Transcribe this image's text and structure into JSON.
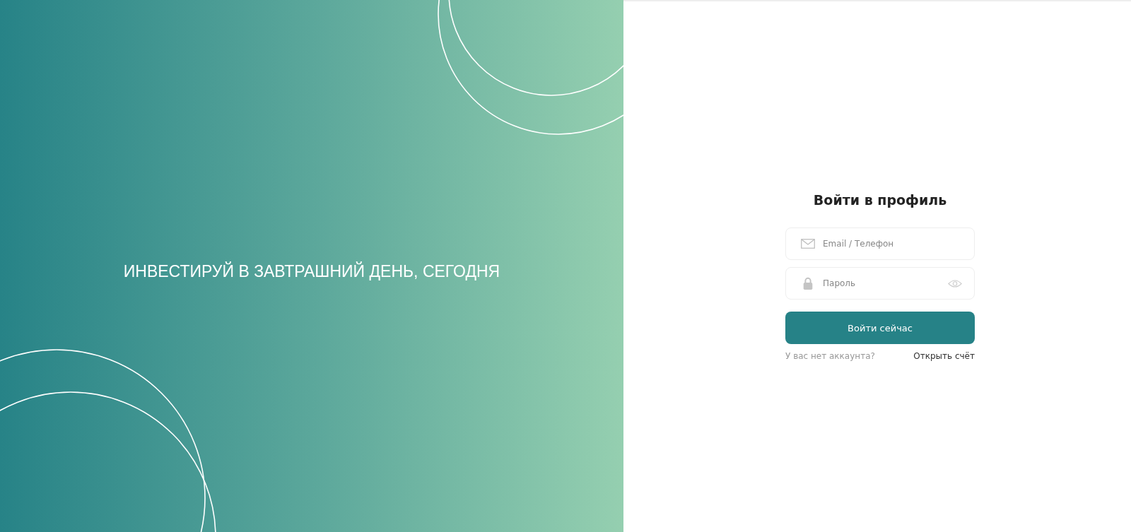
{
  "hero": {
    "slogan": "ИНВЕСТИРУЙ В ЗАВТРАШНИЙ ДЕНЬ, СЕГОДНЯ"
  },
  "login": {
    "title": "Войти в профиль",
    "fields": [
      {
        "kind": "email",
        "placeholder": "Email / Телефон"
      },
      {
        "kind": "password",
        "placeholder": "Пароль"
      }
    ],
    "submit": "Войти сейчас",
    "signup_prompt": "У вас нет аккаунта?",
    "signup_link": "Открыть счёт"
  }
}
